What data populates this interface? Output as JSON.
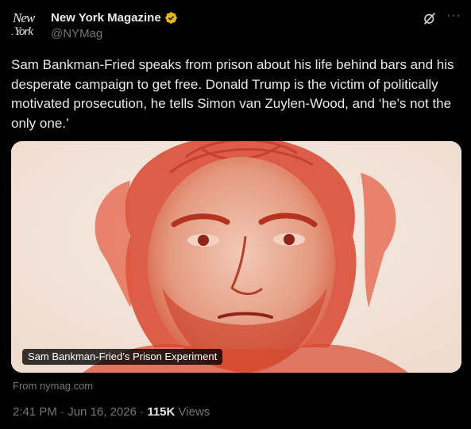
{
  "author": {
    "display_name": "New York Magazine",
    "handle": "@NYMag",
    "avatar_text_line1": "New",
    "avatar_text_line2": "York",
    "avatar_dot": "·",
    "verified_icon": "verified-badge-icon"
  },
  "actions": {
    "grok_icon": "grok-icon",
    "more_label": "···"
  },
  "tweet": {
    "text": "Sam Bankman-Fried speaks from prison about his life behind bars and his desperate campaign to get free. Donald Trump is the victim of politically motivated prosecution, he tells Simon van Zuylen-Wood, and ‘he’s not the only one.’"
  },
  "card": {
    "title": "Sam Bankman-Fried’s Prison Experiment",
    "source": "From nymag.com",
    "image_subject": "red-pencil portrait illustration"
  },
  "meta": {
    "time": "2:41 PM",
    "separator": "·",
    "date": "Jun 16, 2026",
    "views_count": "115K",
    "views_label": "Views"
  },
  "colors": {
    "background": "#000000",
    "text_primary": "#e7e9ea",
    "text_secondary": "#71767b",
    "verified_gold": "#e2b719",
    "illustration_red": "#d9432c"
  }
}
